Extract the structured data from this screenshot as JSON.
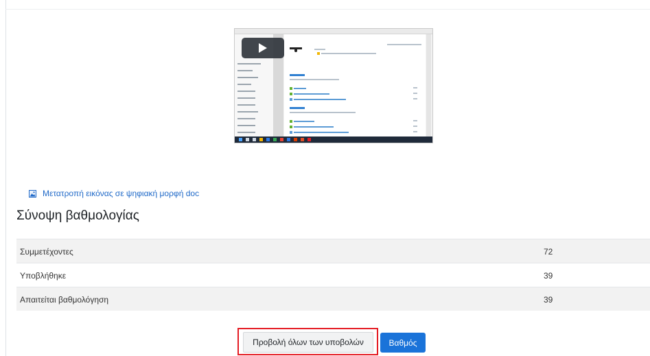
{
  "video": {
    "icon": "play-icon"
  },
  "doc_link": {
    "icon": "file-image-icon",
    "label": "Μετατροπή εικόνας σε ψηφιακή μορφή doc"
  },
  "grading_summary": {
    "title": "Σύνοψη βαθμολογίας",
    "rows": [
      {
        "label": "Συμμετέχοντες",
        "value": "72"
      },
      {
        "label": "Υποβλήθηκε",
        "value": "39"
      },
      {
        "label": "Απαιτείται βαθμολόγηση",
        "value": "39"
      }
    ]
  },
  "actions": {
    "view_all_label": "Προβολή όλων των υποβολών",
    "grade_label": "Βαθμός"
  },
  "colors": {
    "link": "#1f69c8",
    "primary_button": "#1a73d9",
    "highlight": "#e41b23"
  }
}
